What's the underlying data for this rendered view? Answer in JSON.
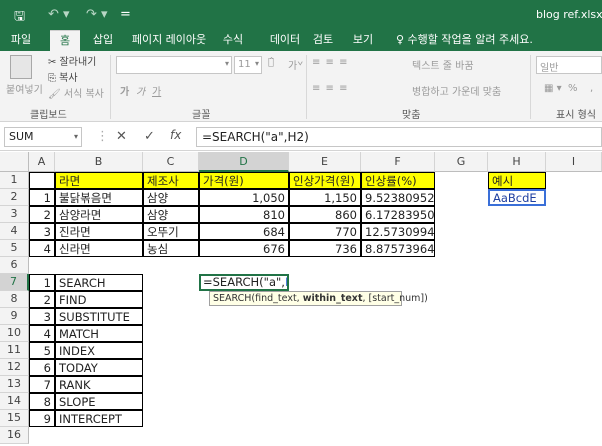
{
  "title": {
    "doc": "blog ref.xlsx - E",
    "qa_save": "🖫",
    "qa_undo": "↶ ▾",
    "qa_redo": "↷ ▾",
    "qa_more": "="
  },
  "tabs": [
    "파일",
    "홈",
    "삽입",
    "페이지 레이아웃",
    "수식",
    "데이터",
    "검토",
    "보기"
  ],
  "tell_me": "♀ 수행할 작업을 알려 주세요.",
  "ribbon": {
    "cut": "✂ 잘라내기",
    "copy": "⎘ 복사",
    "format_painter": "🖌 서식 복사",
    "paste": "붙여넣기",
    "font_size": "11",
    "grow": "가̂",
    "shrink": "가̌",
    "bold": "가",
    "italic": "가",
    "underline": "가",
    "wrap_text": "텍스트 줄 바꿈",
    "merge_center": "병합하고 가운데 맞춤",
    "number_format": "일반",
    "percent": "%",
    "comma": ",",
    "clipboard_label": "클립보드",
    "font_label": "글꼴",
    "align_label": "맞춤",
    "number_label": "표시 형식"
  },
  "formula_bar": {
    "name_box": "SUM",
    "cancel": "✕",
    "enter": "✓",
    "fx": "fx",
    "formula": "=SEARCH(\"a\",H2)"
  },
  "columns": [
    "A",
    "B",
    "C",
    "D",
    "E",
    "F",
    "G",
    "H",
    "I"
  ],
  "rows": [
    "1",
    "2",
    "3",
    "4",
    "5",
    "6",
    "7",
    "8",
    "9",
    "10",
    "11",
    "12",
    "13",
    "14",
    "15",
    "16"
  ],
  "table": {
    "headers": [
      "라면",
      "제조사",
      "가격(원)",
      "인상가격(원)",
      "인상률(%)"
    ],
    "rows": [
      {
        "no": "1",
        "name": "불닭볶음면",
        "maker": "삼양",
        "price": "1,050",
        "new_price": "1,150",
        "rate": "9.523809524"
      },
      {
        "no": "2",
        "name": "삼양라면",
        "maker": "삼양",
        "price": "810",
        "new_price": "860",
        "rate": "6.172839506"
      },
      {
        "no": "3",
        "name": "진라면",
        "maker": "오뚜기",
        "price": "684",
        "new_price": "770",
        "rate": "12.57309942"
      },
      {
        "no": "4",
        "name": "신라면",
        "maker": "농심",
        "price": "676",
        "new_price": "736",
        "rate": "8.875739645"
      }
    ]
  },
  "example": {
    "header": "예시",
    "value": "AaBcdE"
  },
  "functions": [
    {
      "no": "1",
      "name": "SEARCH"
    },
    {
      "no": "2",
      "name": "FIND"
    },
    {
      "no": "3",
      "name": "SUBSTITUTE"
    },
    {
      "no": "4",
      "name": "MATCH"
    },
    {
      "no": "5",
      "name": "INDEX"
    },
    {
      "no": "6",
      "name": "TODAY"
    },
    {
      "no": "7",
      "name": "RANK"
    },
    {
      "no": "8",
      "name": "SLOPE"
    },
    {
      "no": "9",
      "name": "INTERCEPT"
    }
  ],
  "editing": {
    "prefix": "=SEARCH(\"a\",",
    "ref": "H2",
    "suffix": ")"
  },
  "tooltip": {
    "pre": "SEARCH(find_text, ",
    "bold": "within_text",
    "post": ", [start_num])"
  },
  "colors": {
    "accent": "#217346",
    "highlight": "#ffff00",
    "ref_blue": "#3a6fd8"
  }
}
